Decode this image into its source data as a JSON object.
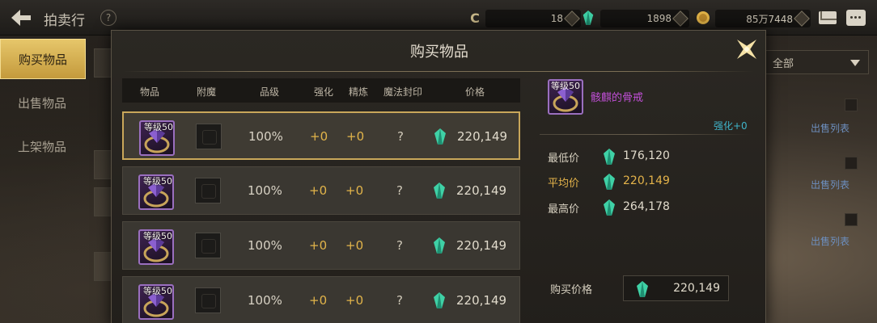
{
  "topbar": {
    "title": "拍卖行",
    "help": "?",
    "currency_symbol": "C",
    "currency_1": "18",
    "currency_2": "1898",
    "currency_3": "85万7448"
  },
  "sidebar": {
    "items": [
      {
        "label": "购买物品",
        "active": true
      },
      {
        "label": "出售物品",
        "active": false
      },
      {
        "label": "上架物品",
        "active": false
      }
    ]
  },
  "background": {
    "filter_selected": "全部",
    "sell_list_label": "出售列表"
  },
  "modal": {
    "title": "购买物品",
    "columns": [
      "物品",
      "附魔",
      "品级",
      "强化",
      "精炼",
      "魔法封印",
      "价格"
    ],
    "listings": [
      {
        "level": "等级50",
        "grade": "100%",
        "strengthen": "+0",
        "refine": "+0",
        "seal": "?",
        "price": "220,149",
        "selected": true
      },
      {
        "level": "等级50",
        "grade": "100%",
        "strengthen": "+0",
        "refine": "+0",
        "seal": "?",
        "price": "220,149",
        "selected": false
      },
      {
        "level": "等级50",
        "grade": "100%",
        "strengthen": "+0",
        "refine": "+0",
        "seal": "?",
        "price": "220,149",
        "selected": false
      },
      {
        "level": "等级50",
        "grade": "100%",
        "strengthen": "+0",
        "refine": "+0",
        "seal": "?",
        "price": "220,149",
        "selected": false
      }
    ],
    "detail": {
      "level": "等级50",
      "name": "骸麒的骨戒",
      "enhance": "强化+0",
      "stats": [
        {
          "label": "最低价",
          "value": "176,120"
        },
        {
          "label": "平均价",
          "value": "220,149"
        },
        {
          "label": "最高价",
          "value": "264,178"
        }
      ],
      "buy_label": "购买价格",
      "buy_value": "220,149"
    }
  },
  "colors": {
    "accent_gold": "#c9a75a",
    "price_gold": "#e4b34a",
    "item_name": "#c04fd6",
    "enhance": "#3fb4c9",
    "gem": "#3fd1a6"
  },
  "icons": {
    "back": "back-arrow-icon",
    "close": "close-star-icon",
    "gem": "gem-icon",
    "ring": "ring-icon",
    "mail": "mail-icon",
    "chat": "chat-icon"
  }
}
